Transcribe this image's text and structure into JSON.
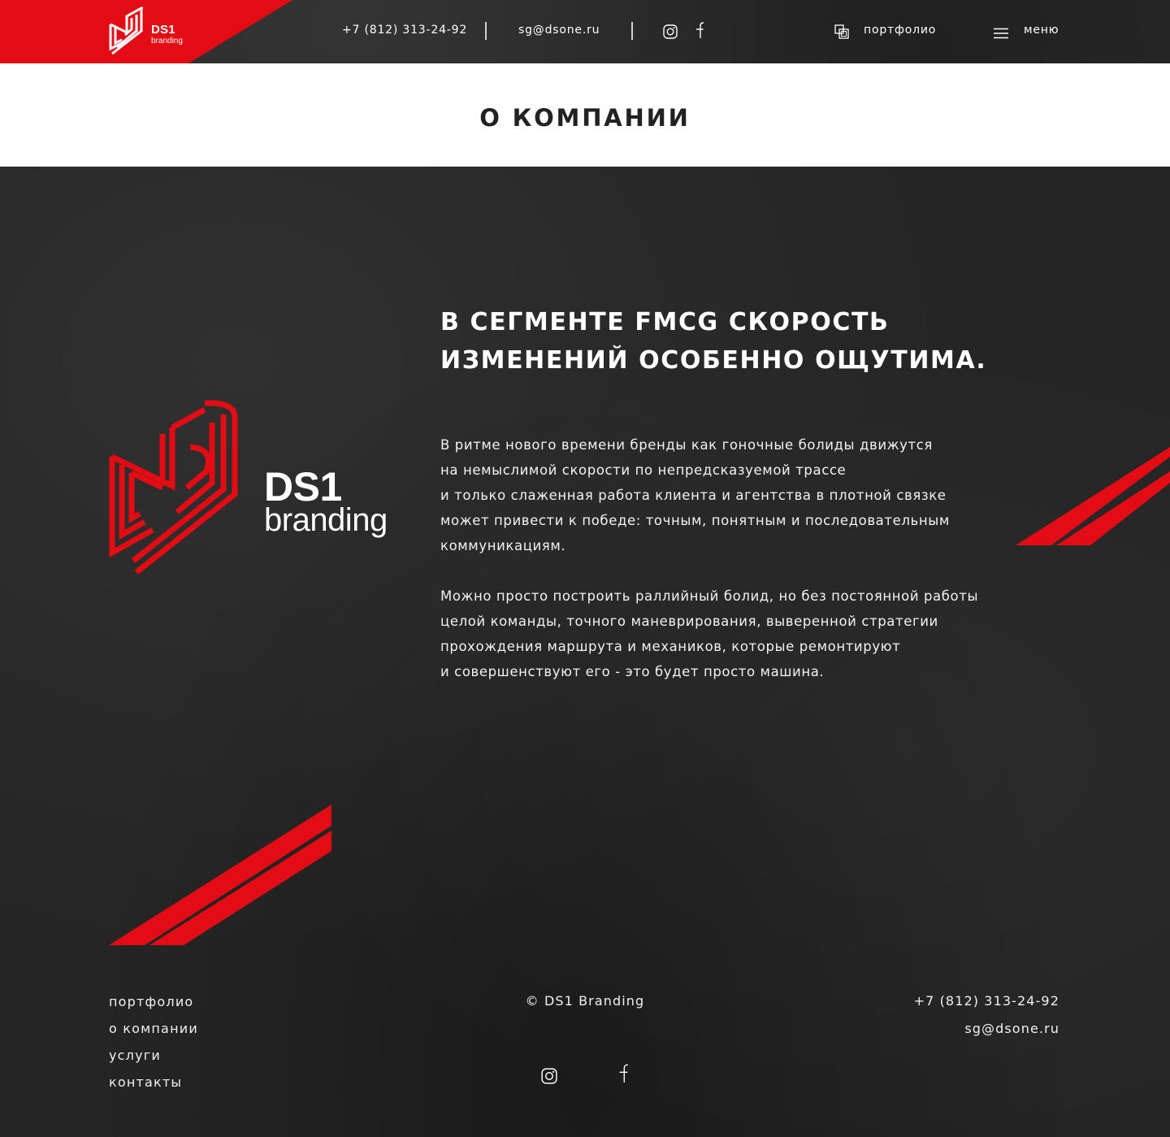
{
  "brand": {
    "name": "DS1",
    "sub": "branding",
    "accent": "#e30b14"
  },
  "header": {
    "phone": "+7 (812) 313-24-92",
    "email": "sg@dsone.ru",
    "portfolio_label": "портфолио",
    "menu_label": "меню",
    "icons": [
      "instagram-icon",
      "facebook-icon",
      "portfolio-icon",
      "menu-icon"
    ]
  },
  "page": {
    "title": "О КОМПАНИИ"
  },
  "content": {
    "headline": "В СЕГМЕНТЕ FMCG СКОРОСТЬ ИЗМЕНЕНИЙ ОСОБЕННО ОЩУТИМА.",
    "paragraph1": "В ритме нового времени бренды как гоночные болиды движутся\nна немыслимой скорости по непредсказуемой трассе\nи только слаженная работа клиента и агентства в плотной связке\nможет привести к победе: точным, понятным и последовательным\nкоммуникациям.",
    "paragraph2": "Можно просто построить раллийный болид, но без постоянной работы\nцелой команды, точного маневрирования, выверенной стратегии\nпрохождения маршрута и механиков, которые ремонтируют\nи совершенствуют его - это будет просто машина."
  },
  "footer": {
    "links": [
      "портфолио",
      "о компании",
      "услуги",
      "контакты"
    ],
    "copyright": "© DS1 Branding",
    "phone": "+7 (812) 313-24-92",
    "email": "sg@dsone.ru"
  }
}
